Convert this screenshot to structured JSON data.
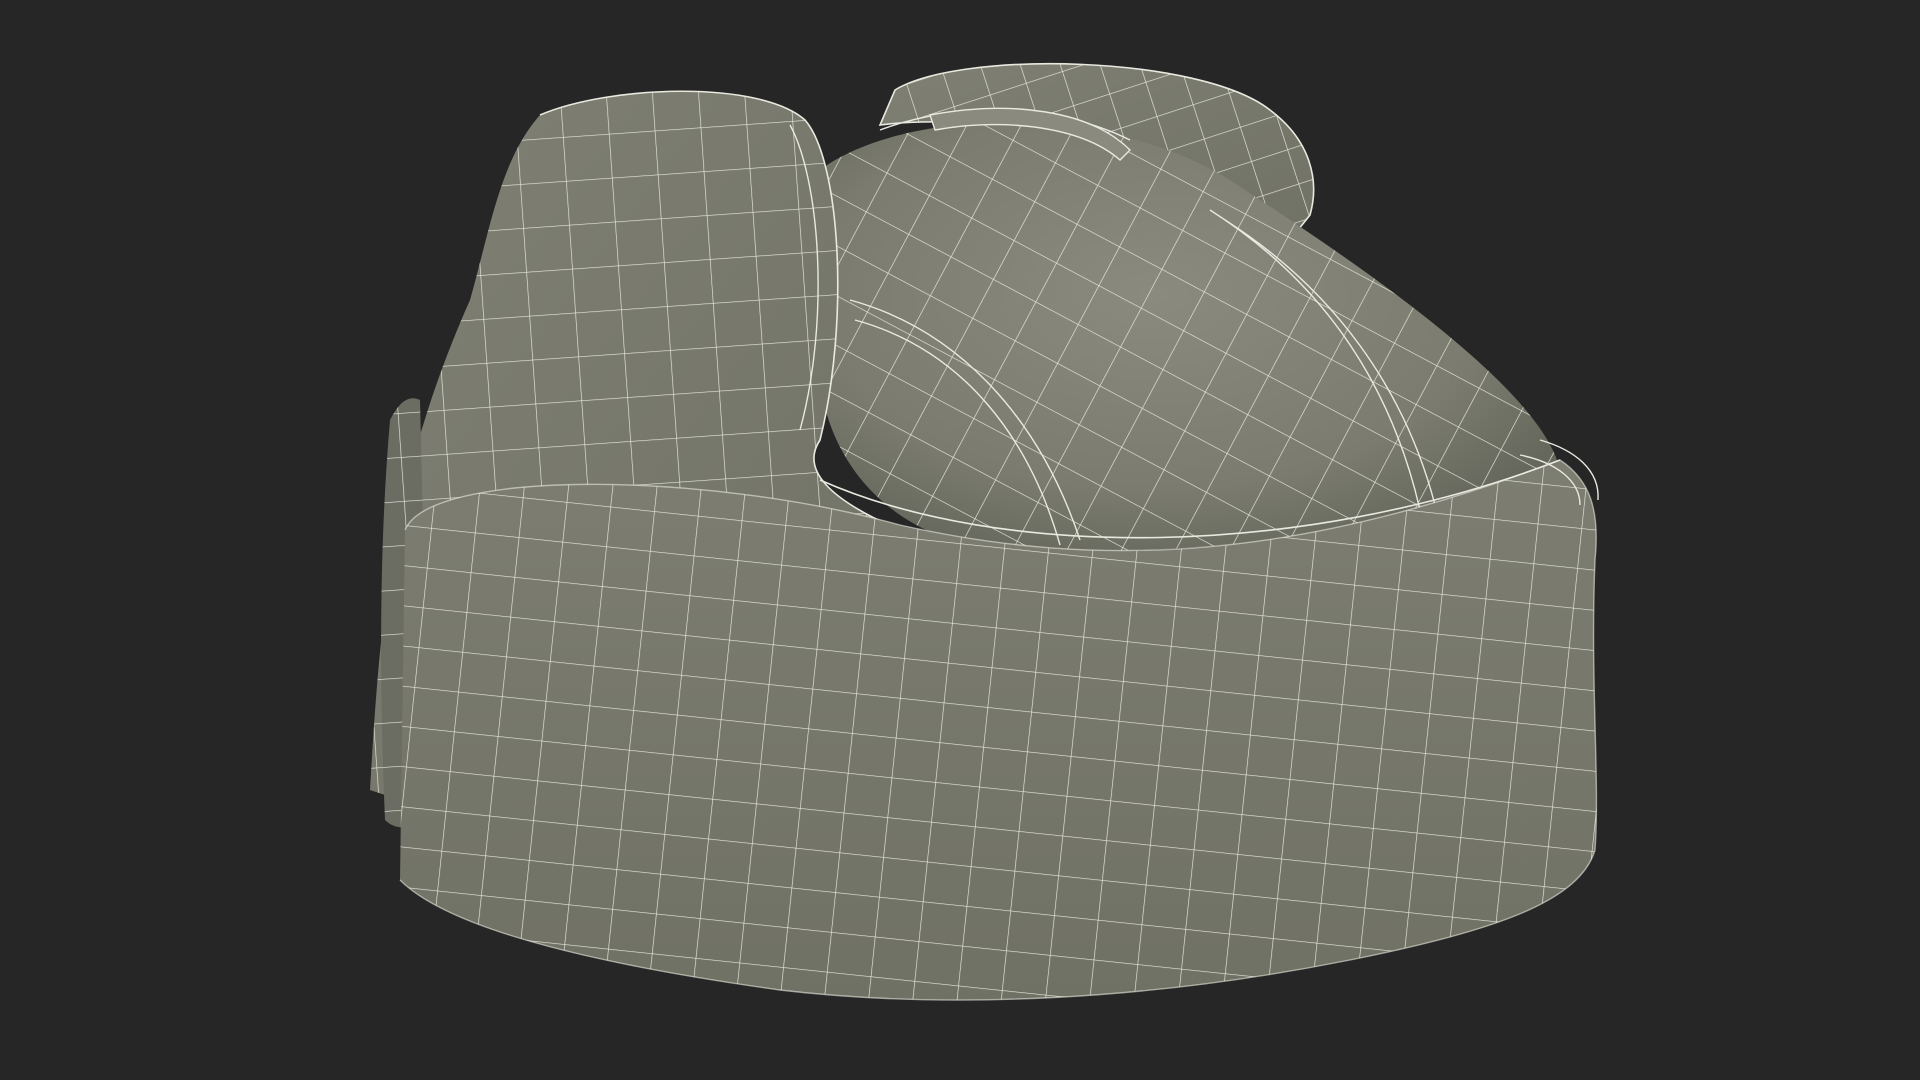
{
  "scene": {
    "subject": "hat-wireframe-model",
    "colors": {
      "background": "#262626",
      "surface": "#7b7c6f",
      "surface_light": "#8a8b7e",
      "surface_dark": "#63645a",
      "wire": "#e9e9e0"
    }
  }
}
